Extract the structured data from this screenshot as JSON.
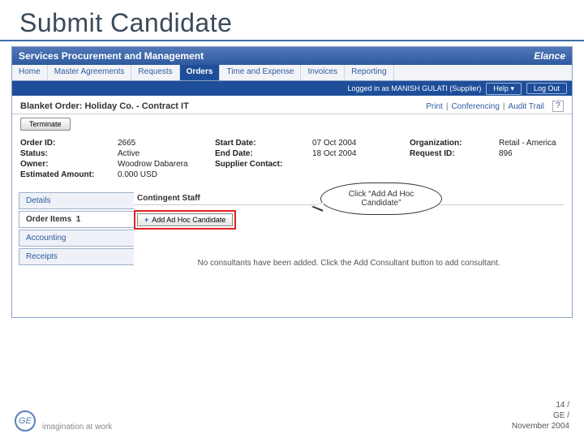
{
  "slide_title": "Submit Candidate",
  "app": {
    "title": "Services Procurement and Management",
    "brand": "Elance"
  },
  "topnav": {
    "items": [
      "Home",
      "Master Agreements",
      "Requests",
      "Orders",
      "Time and Expense",
      "Invoices",
      "Reporting"
    ],
    "active_index": 3
  },
  "subbar": {
    "status_text": "Logged in as MANISH GULATI (Supplier)",
    "help_label": "Help",
    "logout_label": "Log Out"
  },
  "page_header": {
    "title": "Blanket Order: Holiday Co. - Contract IT",
    "right_links": [
      "Print",
      "Conferencing",
      "Audit Trail"
    ],
    "terminate_button": "Terminate"
  },
  "details": {
    "order_id_label": "Order ID:",
    "order_id": "2665",
    "status_label": "Status:",
    "status": "Active",
    "owner_label": "Owner:",
    "owner": "Woodrow Dabarera",
    "est_amount_label": "Estimated Amount:",
    "est_amount": "0.000 USD",
    "start_date_label": "Start Date:",
    "start_date": "07 Oct 2004",
    "end_date_label": "End Date:",
    "end_date": "18 Oct 2004",
    "supplier_contact_label": "Supplier Contact:",
    "supplier_contact": "",
    "organization_label": "Organization:",
    "organization": "Retail - America",
    "request_id_label": "Request ID:",
    "request_id": "896"
  },
  "sidetabs": [
    "Details",
    "Order Items",
    "Accounting",
    "Receipts"
  ],
  "main": {
    "section_title": "Contingent Staff",
    "section_count_prefix": "1",
    "add_button_label": "Add Ad Hoc Candidate",
    "empty_message": "No consultants have been added. Click the Add Consultant button to add consultant."
  },
  "callout_text": "Click “Add Ad Hoc Candidate”",
  "footer": {
    "logo_text": "GE",
    "tagline": "imagination at work",
    "page_num": "14 /",
    "org": "GE /",
    "date": "November 2004"
  }
}
